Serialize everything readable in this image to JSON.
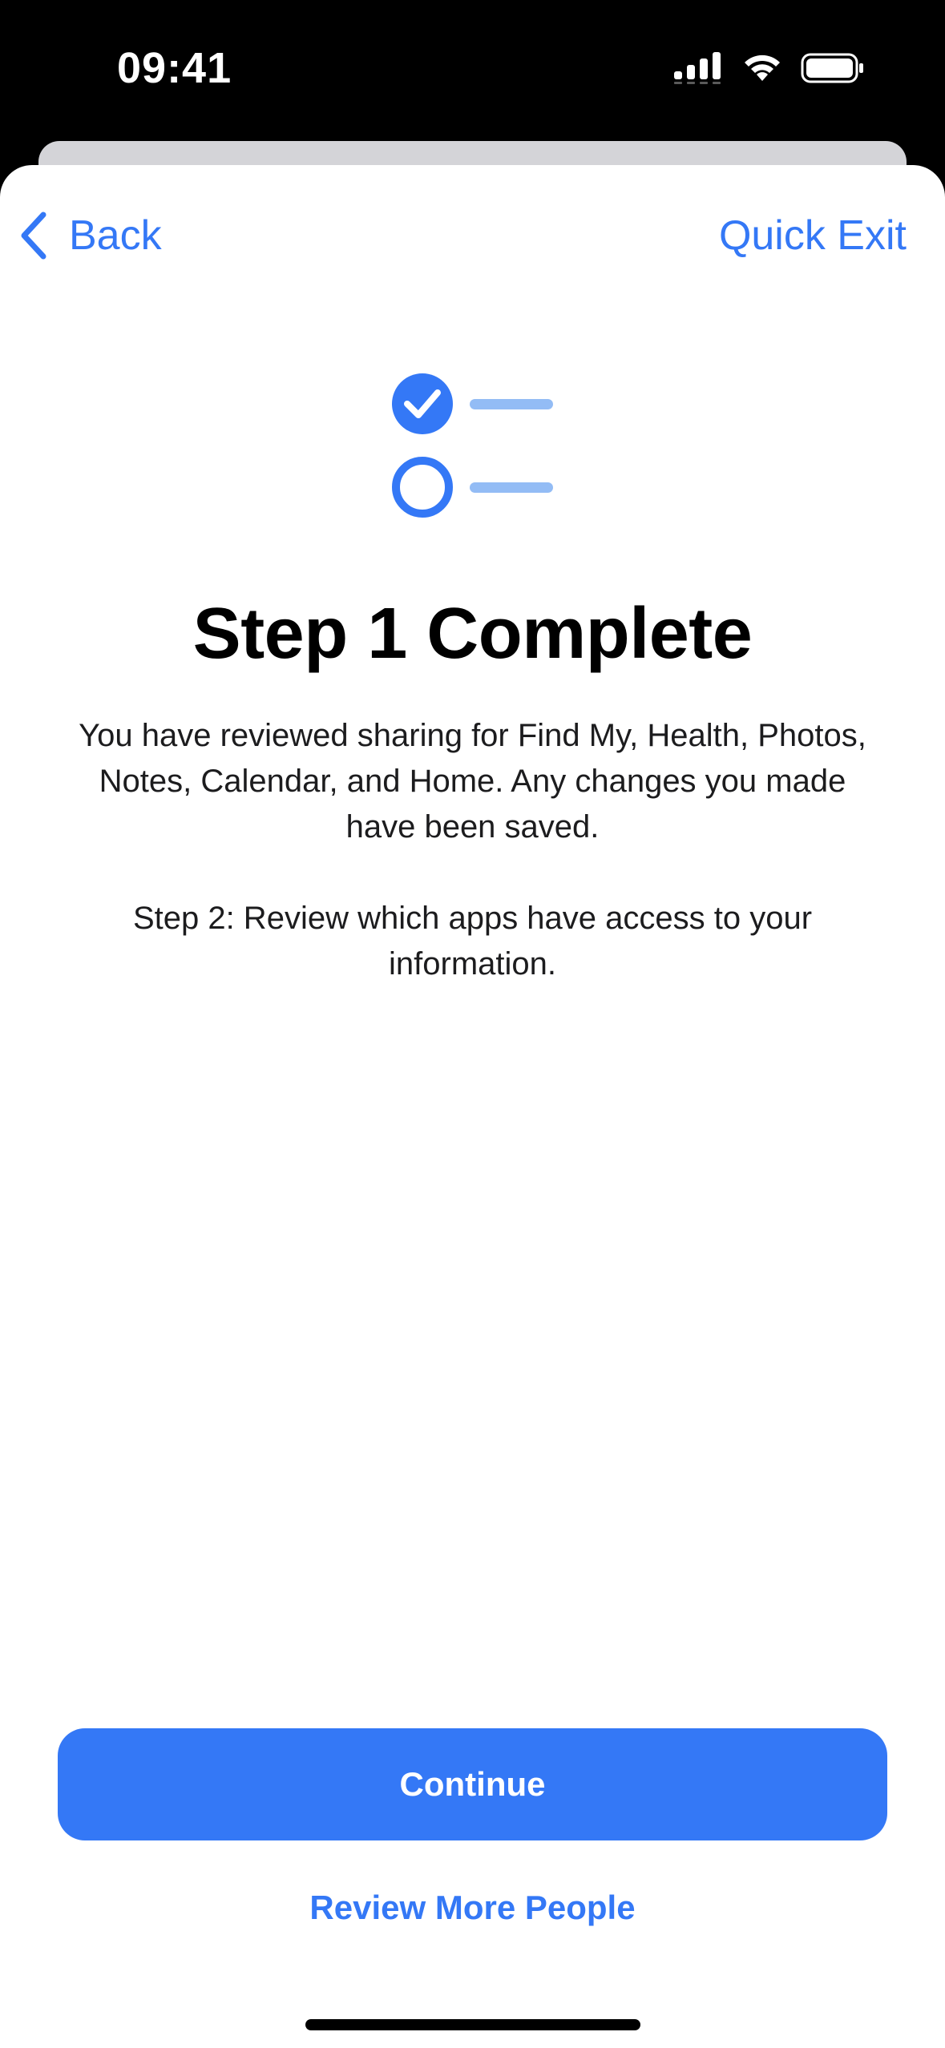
{
  "status_bar": {
    "time": "09:41"
  },
  "nav": {
    "back_label": "Back",
    "quick_exit_label": "Quick Exit"
  },
  "content": {
    "title": "Step 1 Complete",
    "paragraph_1": "You have reviewed sharing for Find My, Health, Photos, Notes, Calendar, and Home. Any changes you made have been saved.",
    "paragraph_2": "Step 2: Review which apps have access to your information."
  },
  "actions": {
    "continue_label": "Continue",
    "review_more_label": "Review More People"
  },
  "icons": {
    "back": "chevron-left-icon",
    "checklist": "checklist-icon",
    "signal": "cellular-signal-icon",
    "wifi": "wifi-icon",
    "battery": "battery-icon"
  },
  "colors": {
    "accent": "#3478f6",
    "accent_light": "#93bcf5",
    "sheet_background": "#ffffff",
    "status_bar_background": "#000000",
    "stacked_card": "#d4d4d8"
  }
}
